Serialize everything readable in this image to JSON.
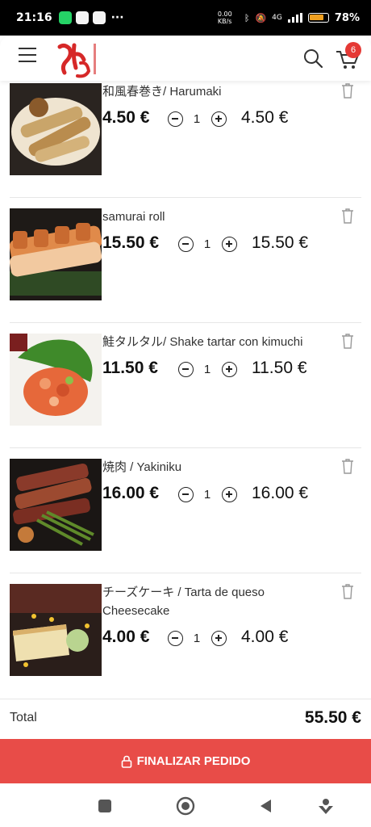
{
  "status_bar": {
    "time": "21:16",
    "more": "···",
    "net_speed": "0.00 KB/s",
    "network": "4G",
    "battery": "78%"
  },
  "header": {
    "logo_icon": "don-logo",
    "search_icon": "search-icon",
    "cart_icon": "cart-icon",
    "cart_count": "6"
  },
  "cart": {
    "items": [
      {
        "name": "和風春巻き/ Harumaki",
        "price": "4.50 €",
        "qty": "1",
        "subtotal": "4.50 €"
      },
      {
        "name": "samurai roll",
        "price": "15.50 €",
        "qty": "1",
        "subtotal": "15.50 €"
      },
      {
        "name": "鮭タルタル/ Shake tartar con kimuchi",
        "price": "11.50 €",
        "qty": "1",
        "subtotal": "11.50 €"
      },
      {
        "name": "焼肉 / Yakiniku",
        "price": "16.00 €",
        "qty": "1",
        "subtotal": "16.00 €"
      },
      {
        "name": "チーズケーキ / Tarta de queso Cheesecake",
        "price": "4.00 €",
        "qty": "1",
        "subtotal": "4.00 €"
      }
    ],
    "total_label": "Total",
    "total_value": "55.50 €",
    "checkout_label": "FINALIZAR PEDIDO"
  },
  "colors": {
    "accent": "#e84c48",
    "badge": "#e53935"
  }
}
